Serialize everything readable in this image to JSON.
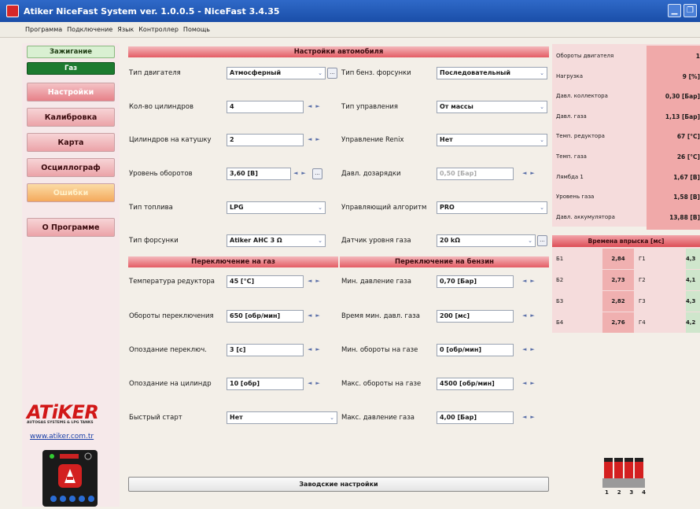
{
  "window": {
    "title": "Atiker NiceFast System ver. 1.0.0.5  -  NiceFast   3.4.35"
  },
  "menu": [
    "Программа",
    "Подключение",
    "Язык",
    "Контроллер",
    "Помощь"
  ],
  "sidebar": {
    "status_petrol": "Зажигание",
    "status_gas": "Газ",
    "buttons": [
      "Настройки",
      "Калибровка",
      "Карта",
      "Осциллограф",
      "Ошибки",
      "О Программе"
    ],
    "logo": "ATiKER",
    "logo_sub": "AUTOGAS SYSTEMS & LPG TANKS",
    "website": "www.atiker.com.tr"
  },
  "settings": {
    "header": "Настройки автомобиля",
    "left": [
      {
        "label": "Тип двигателя",
        "value": "Атмосферный",
        "ctrl": "dd-dots"
      },
      {
        "label": "Кол-во цилиндров",
        "value": "4",
        "ctrl": "spin"
      },
      {
        "label": "Цилиндров на катушку",
        "value": "2",
        "ctrl": "spin"
      },
      {
        "label": "Уровень оборотов",
        "value": "3,60 [В]",
        "ctrl": "spin-dots"
      },
      {
        "label": "Тип топлива",
        "value": "LPG",
        "ctrl": "dd"
      },
      {
        "label": "Тип форсунки",
        "value": "Atiker AHC 3 Ω",
        "ctrl": "dd"
      }
    ],
    "right": [
      {
        "label": "Тип бенз. форсунки",
        "value": "Последовательный",
        "ctrl": "dd"
      },
      {
        "label": "Тип управления",
        "value": "От массы",
        "ctrl": "dd"
      },
      {
        "label": "Управление Renix",
        "value": "Нет",
        "ctrl": "dd"
      },
      {
        "label": "Давл. дозарядки",
        "value": "0,50 [Бар]",
        "ctrl": "spin",
        "disabled": true
      },
      {
        "label": "Управляющий алгоритм",
        "value": "PRO",
        "ctrl": "dd"
      },
      {
        "label": "Датчик уровня газа",
        "value": "20 kΩ",
        "ctrl": "dd-dots"
      }
    ]
  },
  "switch_gas": {
    "header": "Переключение на газ",
    "rows": [
      {
        "label": "Температура редуктора",
        "value": "45 [°C]"
      },
      {
        "label": "Обороты переключения",
        "value": "650 [обр/мин]"
      },
      {
        "label": "Опоздание переключ.",
        "value": "3 [с]"
      },
      {
        "label": "Опоздание на цилиндр",
        "value": "10 [обр]"
      },
      {
        "label": "Быстрый старт",
        "value": "Нет",
        "ctrl": "dd"
      }
    ]
  },
  "switch_petrol": {
    "header": "Переключение на бензин",
    "rows": [
      {
        "label": "Мин. давление газа",
        "value": "0,70 [Бар]"
      },
      {
        "label": "Время мин. давл. газа",
        "value": "200 [мс]"
      },
      {
        "label": "Мин. обороты на газе",
        "value": "0 [обр/мин]"
      },
      {
        "label": "Макс. обороты на газе",
        "value": "4500 [обр/мин]"
      },
      {
        "label": "Макс. давление газа",
        "value": "4,00 [Бар]"
      }
    ]
  },
  "save_button": "Заводские настройки",
  "monitor": [
    {
      "label": "Обороты двигателя",
      "value": "1"
    },
    {
      "label": "Нагрузка",
      "value": "9 [%]"
    },
    {
      "label": "Давл. коллектора",
      "value": "0,30 [Бар]"
    },
    {
      "label": "Давл. газа",
      "value": "1,13 [Бар]"
    },
    {
      "label": "Темп. редуктора",
      "value": "67 [°C]"
    },
    {
      "label": "Темп. газа",
      "value": "26 [°C]"
    },
    {
      "label": "Лямбда 1",
      "value": "1,67 [В]"
    },
    {
      "label": "Уровень газа",
      "value": "1,58 [В]"
    },
    {
      "label": "Давл. аккумулятора",
      "value": "13,88 [В]"
    }
  ],
  "injection": {
    "header": "Времена впрыска [мс]",
    "rows": [
      {
        "b": "Б1",
        "bv": "2,84",
        "g": "Г1",
        "gv": "4,3"
      },
      {
        "b": "Б2",
        "bv": "2,73",
        "g": "Г2",
        "gv": "4,1"
      },
      {
        "b": "Б3",
        "bv": "2,82",
        "g": "Г3",
        "gv": "4,3"
      },
      {
        "b": "Б4",
        "bv": "2,76",
        "g": "Г4",
        "gv": "4,2"
      }
    ]
  },
  "rail_numbers": [
    "1",
    "2",
    "3",
    "4"
  ],
  "colors": {
    "accent": "#e45c64",
    "gas_status": "#1e7a30",
    "title_bar": "#2f69c8"
  }
}
